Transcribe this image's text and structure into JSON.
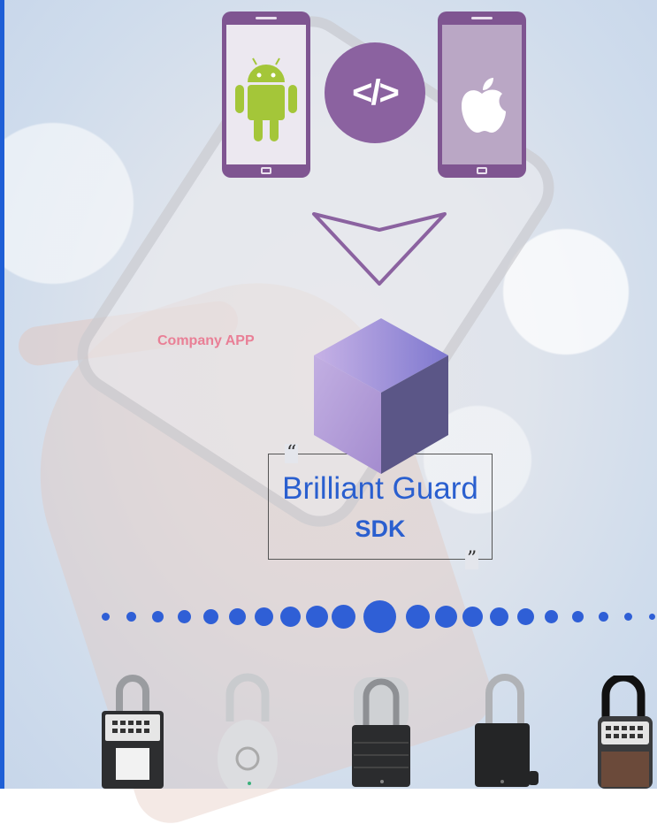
{
  "labels": {
    "code_symbol": "</>",
    "company_app": "Company APP",
    "product_name": "Brilliant Guard",
    "product_type": "SDK",
    "quote_open": "“",
    "quote_close": "”"
  },
  "icons": {
    "left_phone": "android-icon",
    "right_phone": "apple-icon",
    "middle": "code-icon",
    "arrow": "down-arrow-icon",
    "cube": "cube-icon"
  },
  "colors": {
    "phone": "#7f5591",
    "android": "#a4c639",
    "accent_blue": "#2a5fcf",
    "company_pink": "#e97f96",
    "cube_top": "#9a86d8",
    "cube_left": "#b7a2dc",
    "cube_right": "#5a5588"
  },
  "locks": [
    {
      "name": "lockbox-keypad-lock"
    },
    {
      "name": "round-silver-padlock"
    },
    {
      "name": "shrouded-padlock"
    },
    {
      "name": "black-padlock"
    },
    {
      "name": "keypad-padlock"
    }
  ]
}
